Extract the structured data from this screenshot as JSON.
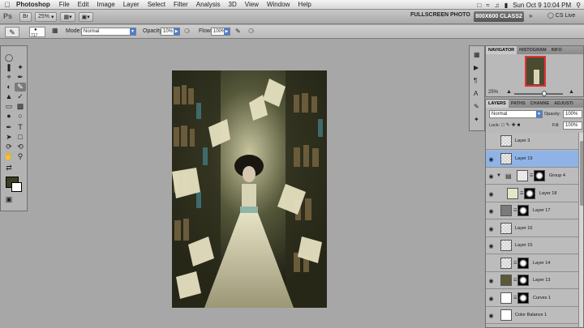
{
  "menubar": {
    "app_name": "Photoshop",
    "menus": [
      "File",
      "Edit",
      "Image",
      "Layer",
      "Select",
      "Filter",
      "Analysis",
      "3D",
      "View",
      "Window",
      "Help"
    ],
    "clock": "Sun Oct 9  10:04 PM"
  },
  "appbar": {
    "logo": "Ps",
    "zoom": "25%",
    "workspace_label": "FULLSCREEN PHOTO",
    "workspace_active": "800X600 CLASS2",
    "cs_live": "CS Live"
  },
  "options": {
    "brush_size": "717",
    "mode_label": "Mode:",
    "mode_value": "Normal",
    "opacity_label": "Opacity:",
    "opacity_value": "10%",
    "flow_label": "Flow:",
    "flow_value": "100%"
  },
  "colors": {
    "foreground": "#3b4023",
    "background": "#ffffff",
    "selection": "#8fb3e6"
  },
  "navigator": {
    "tabs": [
      "NAVIGATOR",
      "HISTOGRAM",
      "INFO"
    ],
    "zoom": "25%"
  },
  "layers_panel": {
    "tabs": [
      "LAYERS",
      "PATHS",
      "CHANNE",
      "ADJUSTI"
    ],
    "blend_mode": "Normal",
    "opacity_label": "Opacity:",
    "opacity_value": "100%",
    "lock_label": "Lock:",
    "fill_label": "Fill:",
    "fill_value": "100%",
    "layers": [
      {
        "name": "Layer 3",
        "visible": false,
        "selected": false
      },
      {
        "name": "Layer 19",
        "visible": true,
        "selected": true
      },
      {
        "name": "Group 4",
        "visible": true,
        "selected": false
      },
      {
        "name": "Layer 18",
        "visible": true,
        "selected": false
      },
      {
        "name": "Layer 17",
        "visible": true,
        "selected": false
      },
      {
        "name": "Layer 16",
        "visible": true,
        "selected": false
      },
      {
        "name": "Layer 15",
        "visible": true,
        "selected": false
      },
      {
        "name": "Layer 14",
        "visible": false,
        "selected": false
      },
      {
        "name": "Layer 13",
        "visible": true,
        "selected": false
      },
      {
        "name": "Curves 1",
        "visible": true,
        "selected": false
      },
      {
        "name": "Color Balance 1",
        "visible": true,
        "selected": false
      }
    ]
  }
}
